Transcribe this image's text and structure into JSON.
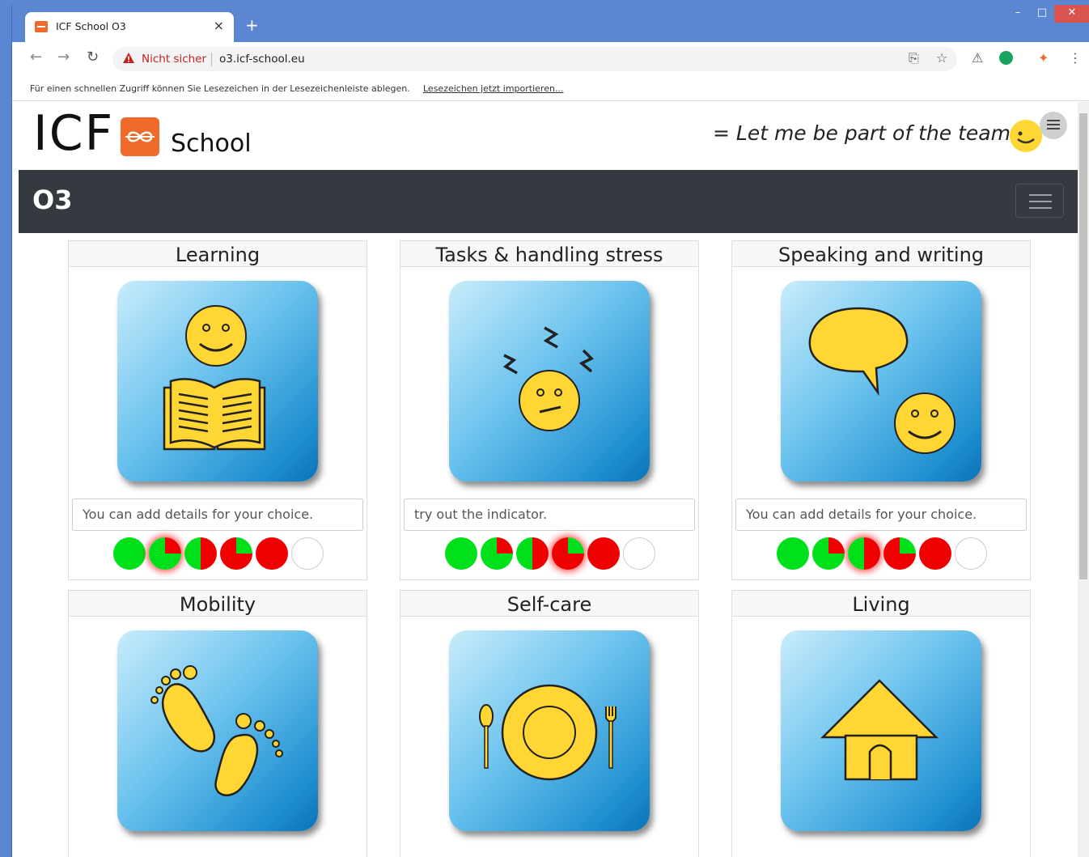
{
  "browser": {
    "tab_title": "ICF School O3",
    "tab_close": "×",
    "new_tab": "+",
    "window_controls": {
      "minimize": "–",
      "maximize": "□",
      "close": "✕"
    },
    "security_warning": "Nicht sicher",
    "url": "o3.icf-school.eu",
    "bookmark_message": "Für einen schnellen Zugriff können Sie Lesezeichen in der Lesezeichenleiste ablegen.",
    "bookmark_link": "Lesezeichen jetzt importieren..."
  },
  "header": {
    "brand_text": "ICF",
    "brand_sub": "School",
    "slogan": "= Let me be part of the team ="
  },
  "navbar": {
    "label": "O3"
  },
  "colors": {
    "navbar_bg": "#343a40",
    "indicator_green": "#00e01a",
    "indicator_red": "#ee0000",
    "logo_orange": "#ef6a2b",
    "icon_yellow": "#ffd633"
  },
  "cards": [
    {
      "title": "Learning",
      "icon": "reading-icon",
      "detail": "You can add details for your choice.",
      "selected_level": 2
    },
    {
      "title": "Tasks & handling stress",
      "icon": "stress-icon",
      "detail": "try out the indicator.",
      "selected_level": 4
    },
    {
      "title": "Speaking and writing",
      "icon": "speech-icon",
      "detail": "You can add details for your choice.",
      "selected_level": 3
    },
    {
      "title": "Mobility",
      "icon": "footprints-icon"
    },
    {
      "title": "Self-care",
      "icon": "plate-icon"
    },
    {
      "title": "Living",
      "icon": "house-icon"
    }
  ],
  "indicator_scale": [
    "green",
    "mostly-green",
    "half",
    "mostly-red",
    "red",
    "none"
  ]
}
